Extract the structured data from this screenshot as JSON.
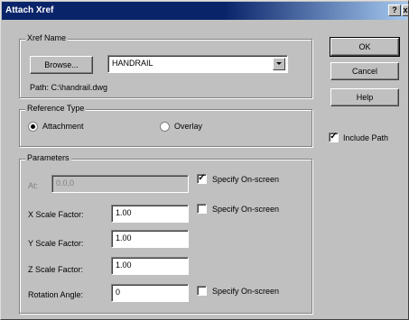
{
  "window": {
    "title": "Attach Xref",
    "help_glyph": "?",
    "close_glyph": "x"
  },
  "xref_name": {
    "group_label": "Xref Name",
    "browse_label": "Browse...",
    "name_value": "HANDRAIL",
    "path_text": "Path: C:\\handrail.dwg"
  },
  "reference_type": {
    "group_label": "Reference Type",
    "attachment_label": "Attachment",
    "overlay_label": "Overlay",
    "selected": "Attachment"
  },
  "parameters": {
    "group_label": "Parameters",
    "at_label": "At:",
    "at_value": "0.0,0",
    "specify_onscreen_label": "Specify On-screen",
    "x_scale_label": "X Scale Factor:",
    "x_scale_value": "1.00",
    "y_scale_label": "Y Scale Factor:",
    "y_scale_value": "1.00",
    "z_scale_label": "Z Scale Factor:",
    "z_scale_value": "1.00",
    "rotation_label": "Rotation Angle:",
    "rotation_value": "0",
    "insertion_specify_checked": true,
    "scale_specify_checked": false,
    "rotation_specify_checked": false
  },
  "buttons": {
    "ok": "OK",
    "cancel": "Cancel",
    "help": "Help"
  },
  "include_path": {
    "label": "Include Path",
    "checked": true
  },
  "colors": {
    "title_active": "#0a246a",
    "face": "#c0c0c0",
    "background": "#000000"
  }
}
